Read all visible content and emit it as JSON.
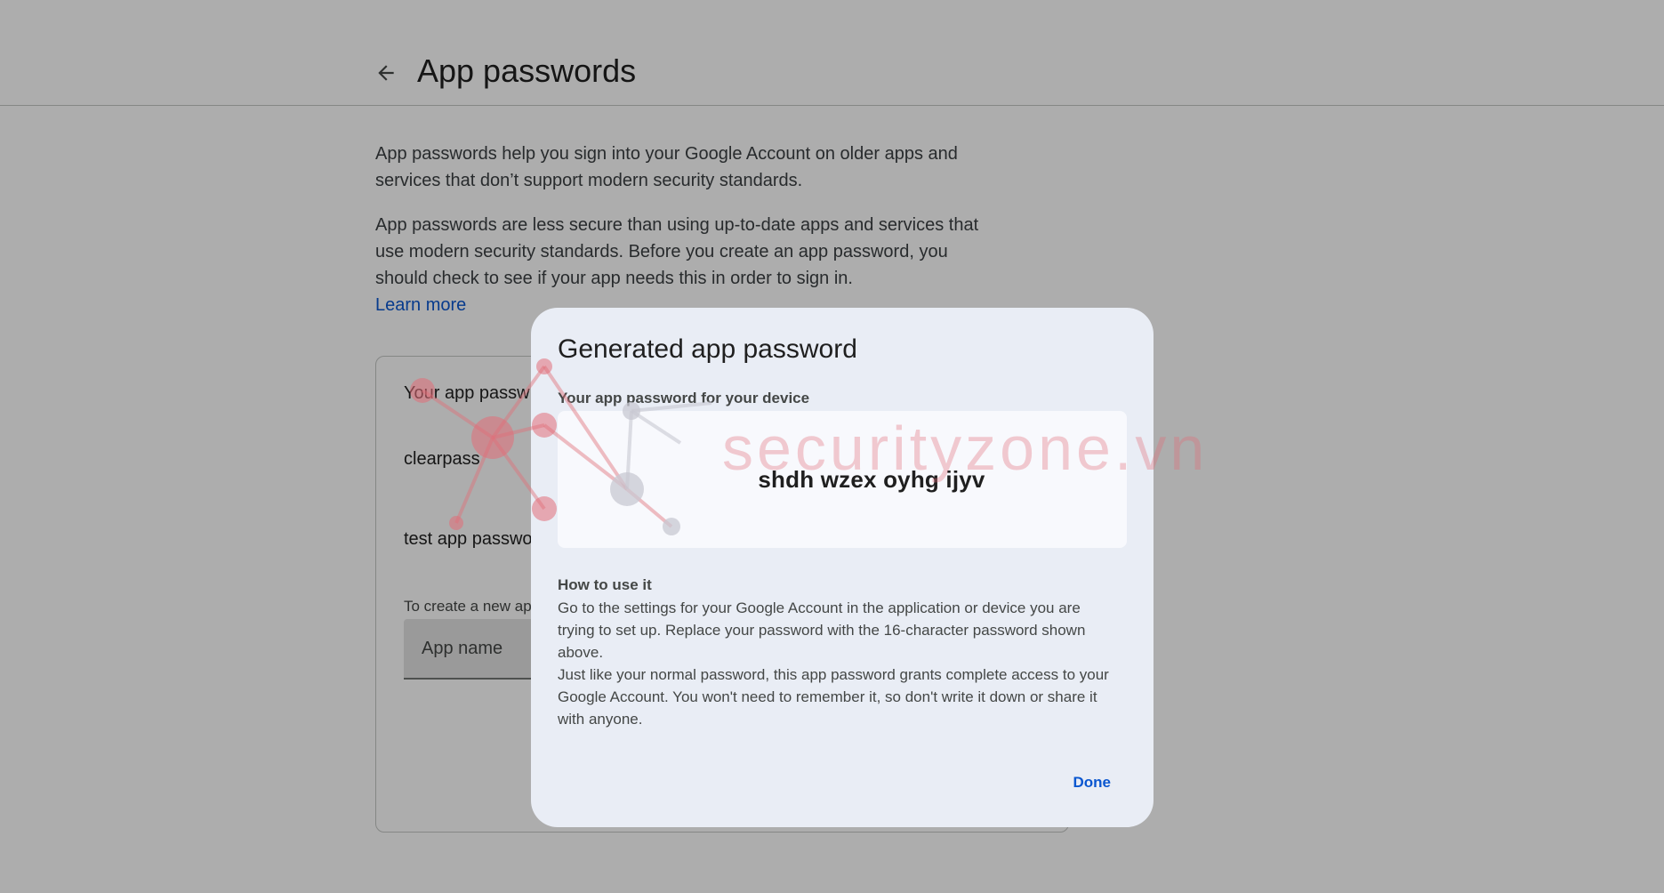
{
  "header": {
    "title": "App passwords",
    "back_icon": "arrow-back-icon"
  },
  "intro": {
    "paragraph1": "App passwords help you sign into your Google Account on older apps and services that don’t support modern security standards.",
    "paragraph2": "App passwords are less secure than using up-to-date apps and services that use modern security standards. Before you create an app password, you should check to see if your app needs this in order to sign in.",
    "learn_more": "Learn more"
  },
  "card": {
    "title": "Your app passw",
    "items": [
      "clearpass",
      "test app passwo"
    ],
    "hint": "To create a new ap",
    "app_name_placeholder": "App name"
  },
  "dialog": {
    "title": "Generated app password",
    "password_label": "Your app password for your device",
    "password_value": "shdh wzex oyhg ijyv",
    "how_title": "How to use it",
    "how_text1": "Go to the settings for your Google Account in the application or device you are trying to set up. Replace your password with the 16-character password shown above.",
    "how_text2": "Just like your normal password, this app password grants complete access to your Google Account. You won't need to remember it, so don't write it down or share it with anyone.",
    "done_label": "Done"
  },
  "watermark": {
    "text": "securityzone.vn"
  },
  "colors": {
    "accent": "#0b57d0",
    "dialog_bg": "#e9edf5",
    "watermark": "#e16e78"
  }
}
